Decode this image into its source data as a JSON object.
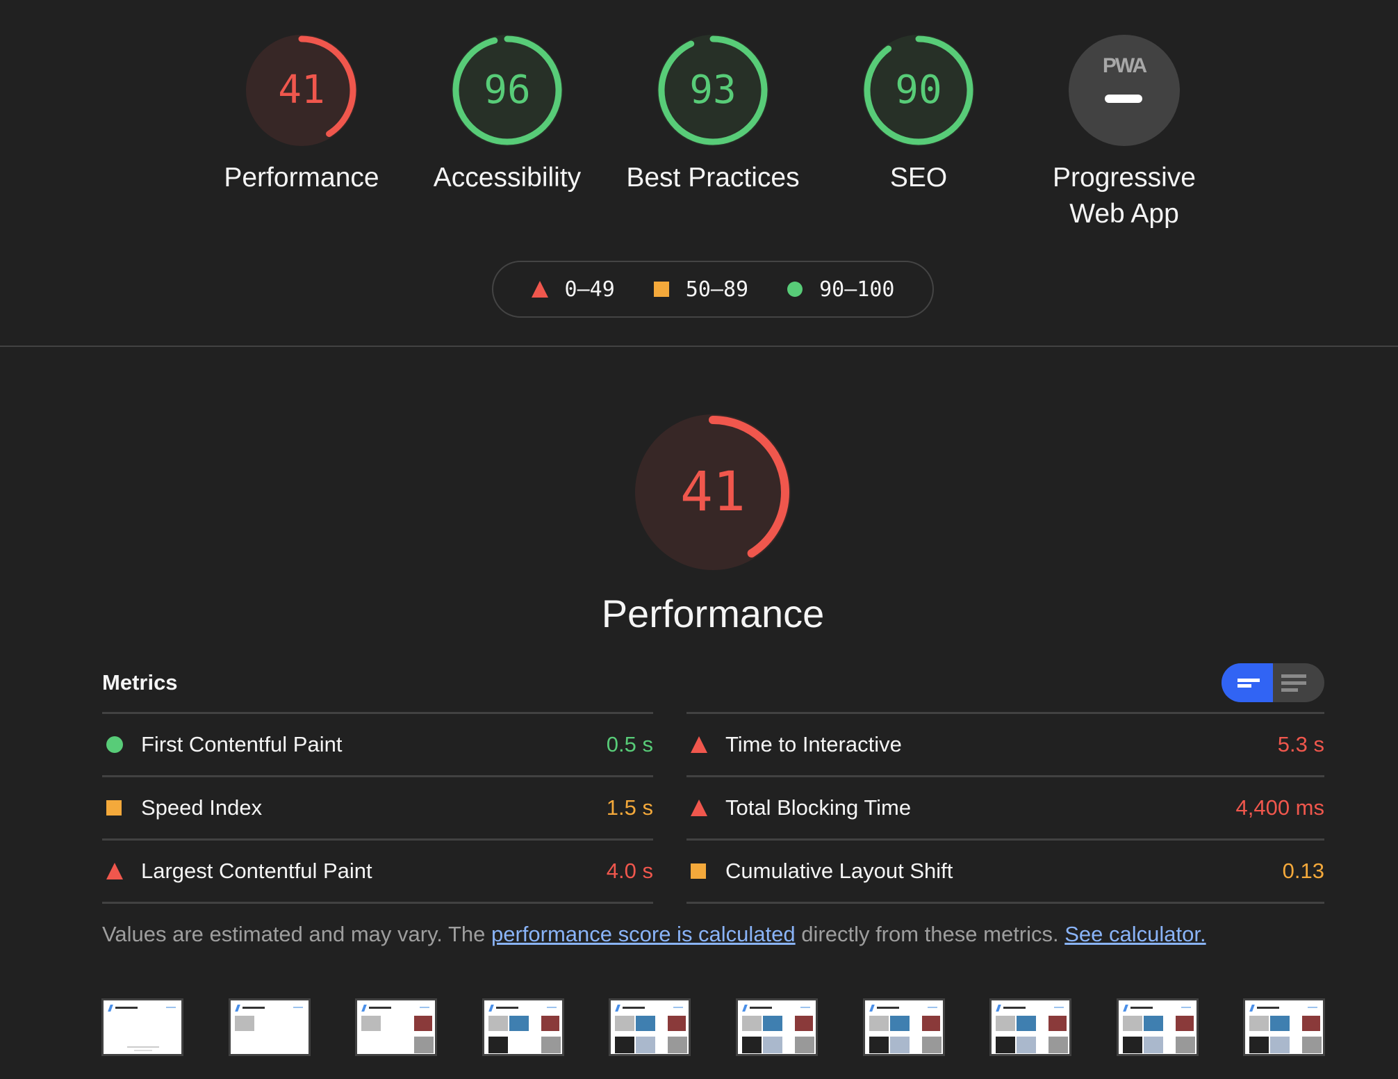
{
  "colors": {
    "fail": "#f0574d",
    "average": "#f4a93b",
    "pass": "#58cc78",
    "fail_bg": "#372726",
    "pass_bg": "#273027",
    "na_bg": "#424242",
    "link": "#8ab4f8",
    "toggle_active": "#3164f4"
  },
  "categories": [
    {
      "label": "Performance",
      "score": 41,
      "rating": "fail"
    },
    {
      "label": "Accessibility",
      "score": 96,
      "rating": "pass"
    },
    {
      "label": "Best Practices",
      "score": 93,
      "rating": "pass"
    },
    {
      "label": "SEO",
      "score": 90,
      "rating": "pass"
    },
    {
      "label": "Progressive Web App",
      "label_line1": "Progressive",
      "label_line2": "Web App",
      "badge": "PWA",
      "score": null,
      "rating": "na"
    }
  ],
  "legend": [
    {
      "icon": "triangle-icon",
      "range": "0–49"
    },
    {
      "icon": "square-icon",
      "range": "50–89"
    },
    {
      "icon": "circle-icon",
      "range": "90–100"
    }
  ],
  "performance": {
    "score": 41,
    "title": "Performance",
    "metrics_title": "Metrics",
    "view_toggle": {
      "options": [
        "summary-view",
        "detailed-view"
      ],
      "selected": "summary-view"
    },
    "metrics_left": [
      {
        "label": "First Contentful Paint",
        "value": "0.5 s",
        "rating": "pass"
      },
      {
        "label": "Speed Index",
        "value": "1.5 s",
        "rating": "average"
      },
      {
        "label": "Largest Contentful Paint",
        "value": "4.0 s",
        "rating": "fail"
      }
    ],
    "metrics_right": [
      {
        "label": "Time to Interactive",
        "value": "5.3 s",
        "rating": "fail"
      },
      {
        "label": "Total Blocking Time",
        "value": "4,400 ms",
        "rating": "fail"
      },
      {
        "label": "Cumulative Layout Shift",
        "value": "0.13",
        "rating": "average"
      }
    ],
    "note": {
      "text_before": "Values are estimated and may vary. The ",
      "link1": "performance score is calculated",
      "text_middle": " directly from these metrics. ",
      "link2": "See calculator."
    },
    "filmstrip_count": 10
  }
}
